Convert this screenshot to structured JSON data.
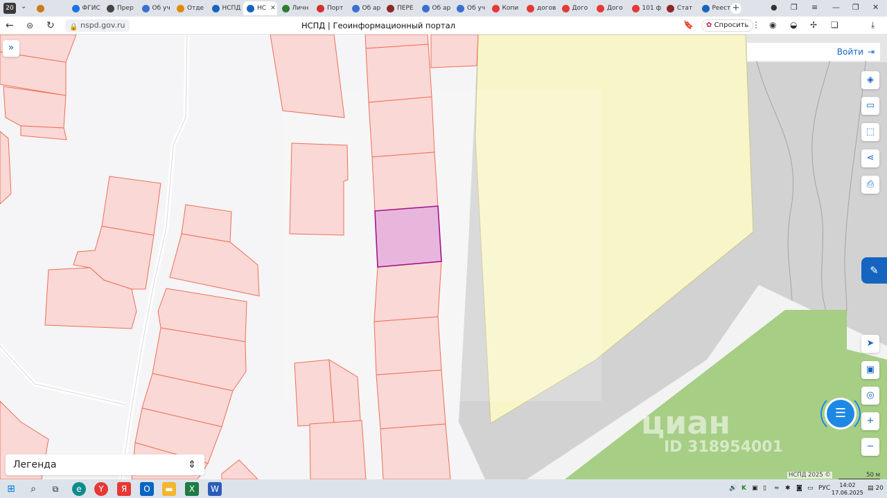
{
  "browser": {
    "tab_count": "20",
    "tabs": [
      {
        "label": "",
        "icon": "shield-icon",
        "color": "#c77d1a"
      },
      {
        "label": "ФГИС",
        "icon": "site-icon",
        "color": "#1a73e8"
      },
      {
        "label": "Прер",
        "icon": "site-icon",
        "color": "#444444"
      },
      {
        "label": "Об уч",
        "icon": "site-icon",
        "color": "#3b6fd1"
      },
      {
        "label": "Отде",
        "icon": "site-icon",
        "color": "#e08a00"
      },
      {
        "label": "НСПД",
        "icon": "site-icon",
        "color": "#1565c0"
      },
      {
        "label": "НС",
        "icon": "site-icon",
        "color": "#1565c0",
        "active": true
      },
      {
        "label": "Личн",
        "icon": "site-icon",
        "color": "#2e7d32"
      },
      {
        "label": "Порт",
        "icon": "flag-icon",
        "color": "#d32f2f"
      },
      {
        "label": "Об ар",
        "icon": "site-icon",
        "color": "#3b6fd1"
      },
      {
        "label": "ПЕРЕ",
        "icon": "site-icon",
        "color": "#8e2727"
      },
      {
        "label": "Об ар",
        "icon": "site-icon",
        "color": "#3b6fd1"
      },
      {
        "label": "Об уч",
        "icon": "site-icon",
        "color": "#3b6fd1"
      },
      {
        "label": "Копи",
        "icon": "site-icon",
        "color": "#e53935"
      },
      {
        "label": "догов",
        "icon": "site-icon",
        "color": "#e53935"
      },
      {
        "label": "Дого",
        "icon": "site-icon",
        "color": "#e53935"
      },
      {
        "label": "Дого",
        "icon": "site-icon",
        "color": "#e53935"
      },
      {
        "label": "101 ф",
        "icon": "site-icon",
        "color": "#e53935"
      },
      {
        "label": "Стат",
        "icon": "site-icon",
        "color": "#8e2727"
      },
      {
        "label": "Реест",
        "icon": "site-icon",
        "color": "#1565c0"
      }
    ],
    "url": "nspd.gov.ru",
    "title": "НСПД | Геоинформационный портал",
    "ask_label": "Спросить"
  },
  "map": {
    "login_label": "Войти",
    "legend_label": "Легенда",
    "copyright": "НСПД 2025 ©",
    "scale_label": "50 м",
    "watermark": "циан",
    "watermark_id": "ID 318954001",
    "colors": {
      "parcel_fill": "#f9d8d6",
      "parcel_stroke": "#ee6f55",
      "selected_fill": "#e8b6dd",
      "selected_stroke": "#a0148c",
      "yellow_zone": "#f8f5c9",
      "green_zone": "#a6ce85",
      "road": "#d0d0d0",
      "accent": "#1565c0"
    }
  },
  "taskbar": {
    "lang": "РУС",
    "time": "14:02",
    "date": "17.06.2025",
    "notifications": "20"
  }
}
